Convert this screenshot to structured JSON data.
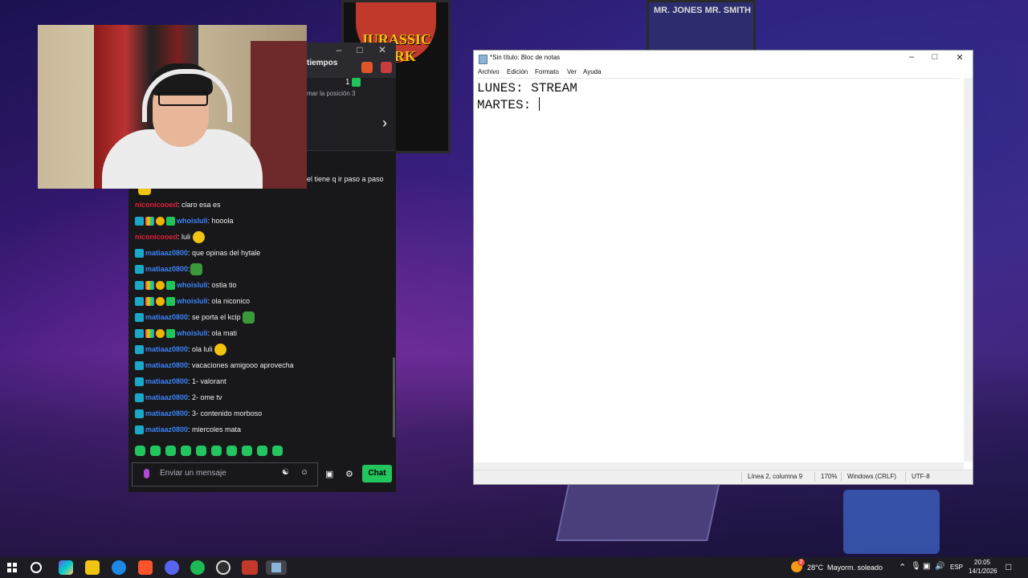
{
  "background": {
    "poster_left_text": "JURASSIC PARK",
    "poster_right_text": "MR. JONES  MR. SMITH"
  },
  "chat": {
    "header_title": "tiempos",
    "header_count": "1",
    "header_sub": "mar la posición 3",
    "partial_message": "el tiene q ir paso a paso",
    "messages": [
      {
        "user": "niconicooed",
        "text": ": claro esa es",
        "color": "red",
        "badges": []
      },
      {
        "user": "whoisluli",
        "text": ": hooola",
        "color": "blue",
        "badges": [
          "sub",
          "pride",
          "coin",
          "green"
        ]
      },
      {
        "user": "niconicooed",
        "text": ": luli",
        "color": "red",
        "badges": [],
        "emote": "yellow"
      },
      {
        "user": "matiaaz0800",
        "text": ": que opinas del hytale",
        "color": "blue",
        "badges": [
          "sub"
        ]
      },
      {
        "user": "matiaaz0800",
        "text": ":",
        "color": "blue",
        "badges": [
          "sub"
        ],
        "emote": "pepe"
      },
      {
        "user": "whoisluli",
        "text": ": ostia tio",
        "color": "blue",
        "badges": [
          "sub",
          "pride",
          "coin",
          "green"
        ]
      },
      {
        "user": "whoisluli",
        "text": ": ola niconico",
        "color": "blue",
        "badges": [
          "sub",
          "pride",
          "coin",
          "green"
        ]
      },
      {
        "user": "matiaaz0800",
        "text": ": se porta el kcip",
        "color": "blue",
        "badges": [
          "sub"
        ],
        "emote": "pepe"
      },
      {
        "user": "whoisluli",
        "text": ": ola mati",
        "color": "blue",
        "badges": [
          "sub",
          "pride",
          "coin",
          "green"
        ]
      },
      {
        "user": "matiaaz0800",
        "text": ": ola luli",
        "color": "blue",
        "badges": [
          "sub"
        ],
        "emote": "yellow"
      },
      {
        "user": "matiaaz0800",
        "text": ": vacaciones amigooo aprovecha",
        "color": "blue",
        "badges": [
          "sub"
        ]
      },
      {
        "user": "matiaaz0800",
        "text": ": 1- valorant",
        "color": "blue",
        "badges": [
          "sub"
        ]
      },
      {
        "user": "matiaaz0800",
        "text": ": 2- ome tv",
        "color": "blue",
        "badges": [
          "sub"
        ]
      },
      {
        "user": "matiaaz0800",
        "text": ": 3- contenido morboso",
        "color": "blue",
        "badges": [
          "sub"
        ]
      },
      {
        "user": "matiaaz0800",
        "text": ": miercoles mata",
        "color": "blue",
        "badges": [
          "sub"
        ]
      }
    ],
    "input_placeholder": "Enviar un mensaje",
    "send_label": "Chat",
    "colors": {
      "accent": "#22c55e",
      "red_user": "#e01e3c",
      "blue_user": "#3b82f6"
    }
  },
  "notepad": {
    "title": "*Sin título: Bloc de notas",
    "menu": [
      "Archivo",
      "Edición",
      "Formato",
      "Ver",
      "Ayuda"
    ],
    "lines": [
      "LUNES: STREAM",
      "MARTES: "
    ],
    "status": {
      "position": "Línea 2, columna 9",
      "zoom": "170%",
      "line_endings": "Windows (CRLF)",
      "encoding": "UTF-8"
    }
  },
  "taskbar": {
    "weather_temp": "28°C",
    "weather_text": "Mayorm. soleado",
    "weather_badge": "2",
    "language": "ESP",
    "time": "20:05",
    "date": "14/1/2026",
    "apps": [
      "search-icon",
      "copilot-icon",
      "file-explorer-icon",
      "edge-icon",
      "brave-icon",
      "discord-icon",
      "spotify-icon",
      "obs-icon",
      "video-editor-icon",
      "notepad-icon"
    ]
  }
}
